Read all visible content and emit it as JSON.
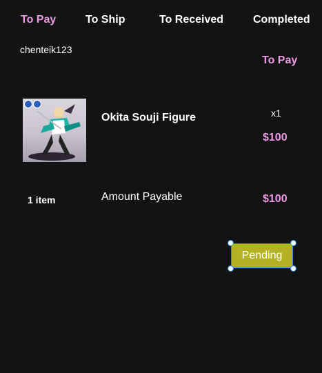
{
  "tabs": [
    {
      "label": "To Pay",
      "active": true
    },
    {
      "label": "To Ship",
      "active": false
    },
    {
      "label": "To Received",
      "active": false
    },
    {
      "label": "Completed",
      "active": false
    }
  ],
  "order": {
    "username": "chenteik123",
    "status": "To Pay",
    "product": {
      "name": "Okita Souji Figure",
      "quantity": "x1",
      "price": "$100",
      "image_icon": "figure-photo"
    },
    "summary": {
      "item_count": "1 item",
      "amount_label": "Amount Payable",
      "amount": "$100"
    },
    "action": {
      "label": "Pending",
      "color": "#b4b223"
    }
  },
  "colors": {
    "background": "#131313",
    "accent": "#ef9ae6",
    "text": "#ffffff",
    "selection": "#1e88e5"
  }
}
